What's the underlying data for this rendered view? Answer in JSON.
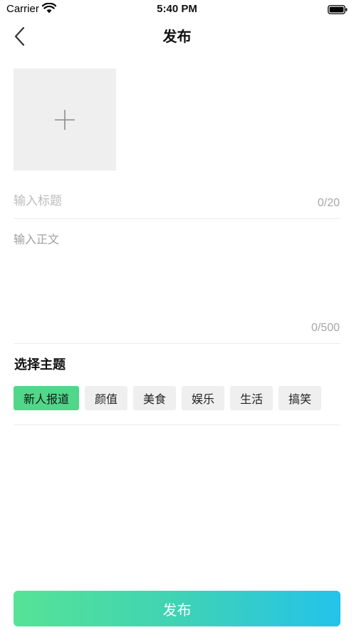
{
  "status_bar": {
    "carrier": "Carrier",
    "time": "5:40 PM",
    "icons": [
      "wifi-icon",
      "battery-icon"
    ]
  },
  "nav": {
    "back_icon": "chevron-left-icon",
    "title": "发布"
  },
  "upload": {
    "icon": "plus-icon"
  },
  "title_field": {
    "value": "",
    "placeholder": "输入标题",
    "counter": "0/20"
  },
  "body_field": {
    "value": "",
    "placeholder": "输入正文",
    "counter": "0/500"
  },
  "topics": {
    "heading": "选择主题",
    "selected": "新人报道",
    "items": [
      {
        "label": "新人报道"
      },
      {
        "label": "颜值"
      },
      {
        "label": "美食"
      },
      {
        "label": "娱乐"
      },
      {
        "label": "生活"
      },
      {
        "label": "搞笑"
      }
    ]
  },
  "footer": {
    "publish_label": "发布"
  },
  "colors": {
    "accent_start": "#56e396",
    "accent_end": "#24c3ea",
    "chip_selected": "#52d68a",
    "chip_default": "#efefef"
  }
}
